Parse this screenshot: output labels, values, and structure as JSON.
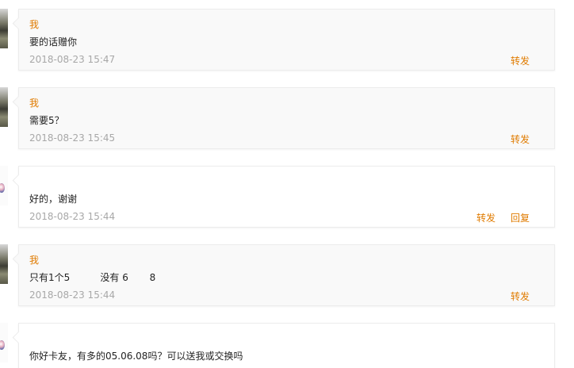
{
  "messages": [
    {
      "type": "me",
      "author": "我",
      "text": "要的话赠你",
      "time": "2018-08-23 15:47",
      "actions": [
        "转发"
      ]
    },
    {
      "type": "me",
      "author": "我",
      "text": "需要5？",
      "time": "2018-08-23 15:45",
      "actions": [
        "转发"
      ]
    },
    {
      "type": "other",
      "author": "",
      "text": "好的，谢谢",
      "time": "2018-08-23 15:44",
      "actions": [
        "转发",
        "回复"
      ]
    },
    {
      "type": "me",
      "author": "我",
      "text": "只有1个5          没有 6       8",
      "time": "2018-08-23 15:44",
      "actions": [
        "转发"
      ]
    },
    {
      "type": "other",
      "author": "",
      "text": "你好卡友，有多的05.06.08吗？可以送我或交换吗",
      "time": "",
      "actions": []
    }
  ],
  "colors": {
    "accent": "#e07b00",
    "timestamp": "#a8a8a8",
    "bubble_me": "#f9f9f9",
    "bubble_other": "#ffffff",
    "border": "#ececec"
  },
  "icons": {
    "me_avatar": "user-avatar-icon",
    "other_avatar": "user-avatar-icon"
  }
}
